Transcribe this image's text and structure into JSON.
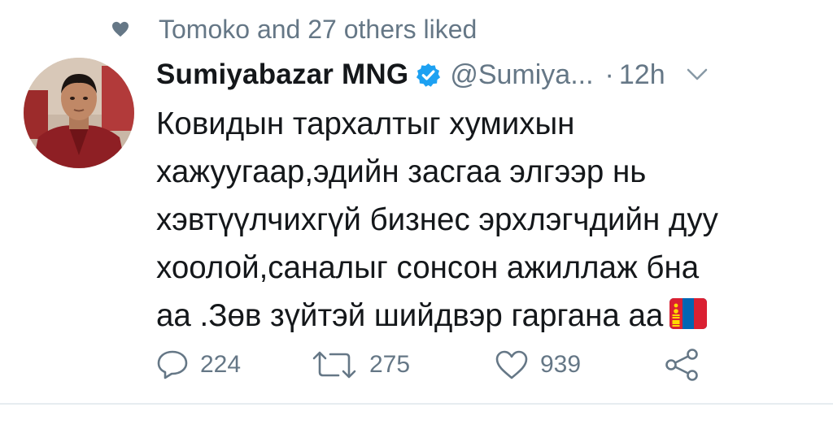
{
  "social_context": {
    "text": "Tomoko and 27 others liked",
    "icon": "heart-icon"
  },
  "author": {
    "display_name": "Sumiyabazar MNG",
    "handle": "@Sumiya...",
    "separator": "·",
    "timestamp": "12h",
    "verified": true
  },
  "tweet": {
    "lines": [
      "Ковидын тархалтыг хумихын",
      "хажуугаар,эдийн засгаа элгээр нь",
      "хэвтүүлчихгүй бизнес эрхлэгчдийн дуу",
      "хоолой,саналыг сонсон ажиллаж бна",
      "аа .Зөв зүйтэй шийдвэр гаргана аа"
    ],
    "emoji": "flag-mongolia"
  },
  "actions": {
    "reply_count": "224",
    "retweet_count": "275",
    "like_count": "939",
    "icons": [
      "reply-icon",
      "retweet-icon",
      "like-icon",
      "share-icon"
    ]
  },
  "colors": {
    "text": "#14171a",
    "secondary": "#657786",
    "verified_blue": "#1da1f2",
    "divider": "#e6ecf0",
    "flag_red": "#da2032",
    "flag_blue": "#0066b3",
    "flag_gold": "#ffd900"
  }
}
